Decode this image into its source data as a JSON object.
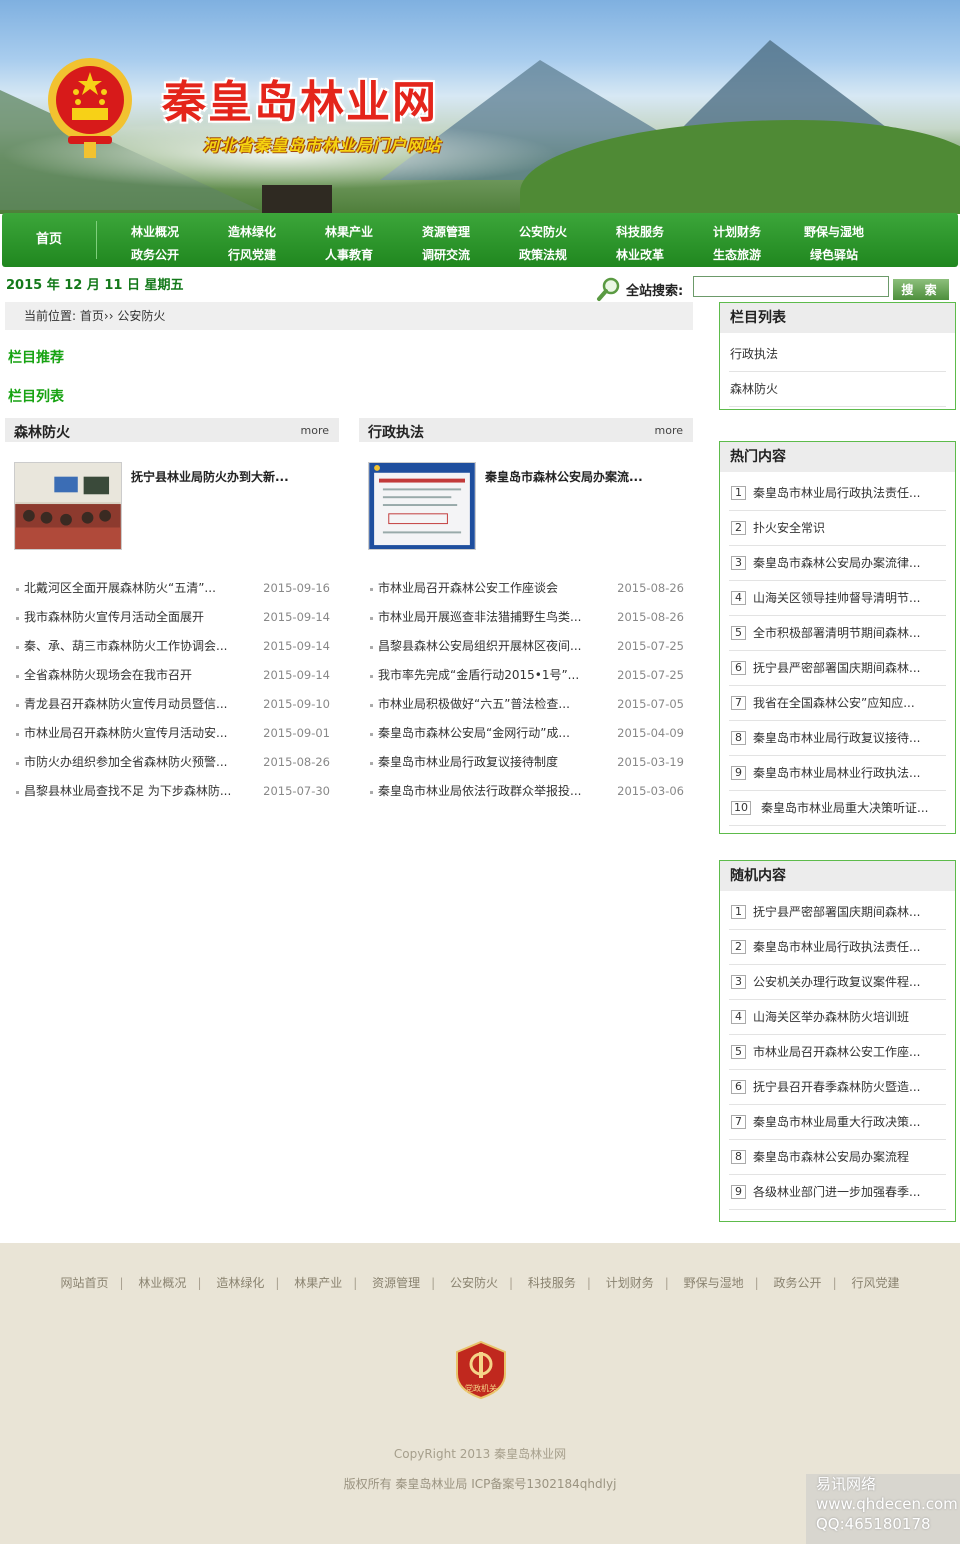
{
  "header": {
    "site_title": "秦皇岛林业网",
    "site_subtitle": "河北省秦皇岛市林业局门户网站"
  },
  "nav": {
    "home": "首页",
    "columns": [
      [
        "林业概况",
        "政务公开"
      ],
      [
        "造林绿化",
        "行风党建"
      ],
      [
        "林果产业",
        "人事教育"
      ],
      [
        "资源管理",
        "调研交流"
      ],
      [
        "公安防火",
        "政策法规"
      ],
      [
        "科技服务",
        "林业改革"
      ],
      [
        "计划财务",
        "生态旅游"
      ],
      [
        "野保与湿地",
        "绿色驿站"
      ]
    ]
  },
  "date": "2015 年 12 月 11 日 星期五",
  "search": {
    "label": "全站搜索:",
    "value": "",
    "button": "搜 索"
  },
  "breadcrumb": {
    "prefix": "当前位置:",
    "home": "首页",
    "sep": "››",
    "current": "公安防火"
  },
  "sections": {
    "recommend": "栏目推荐",
    "list": "栏目列表"
  },
  "boxes": [
    {
      "title": "森林防火",
      "more": "more",
      "lead": "抚宁县林业局防火办到大新...",
      "items": [
        {
          "title": "北戴河区全面开展森林防火“五清”...",
          "date": "2015-09-16"
        },
        {
          "title": "我市森林防火宣传月活动全面展开",
          "date": "2015-09-14"
        },
        {
          "title": "秦、承、葫三市森林防火工作协调会...",
          "date": "2015-09-14"
        },
        {
          "title": "全省森林防火现场会在我市召开",
          "date": "2015-09-14"
        },
        {
          "title": "青龙县召开森林防火宣传月动员暨信...",
          "date": "2015-09-10"
        },
        {
          "title": "市林业局召开森林防火宣传月活动安...",
          "date": "2015-09-01"
        },
        {
          "title": "市防火办组织参加全省森林防火预警...",
          "date": "2015-08-26"
        },
        {
          "title": "昌黎县林业局查找不足 为下步森林防...",
          "date": "2015-07-30"
        }
      ]
    },
    {
      "title": "行政执法",
      "more": "more",
      "lead": "秦皇岛市森林公安局办案流...",
      "items": [
        {
          "title": "市林业局召开森林公安工作座谈会",
          "date": "2015-08-26"
        },
        {
          "title": "市林业局开展巡查非法猎捕野生鸟类...",
          "date": "2015-08-26"
        },
        {
          "title": "昌黎县森林公安局组织开展林区夜间...",
          "date": "2015-07-25"
        },
        {
          "title": "我市率先完成“金盾行动2015•1号”...",
          "date": "2015-07-25"
        },
        {
          "title": "市林业局积极做好“六五”普法检查...",
          "date": "2015-07-05"
        },
        {
          "title": "秦皇岛市森林公安局“金网行动”成...",
          "date": "2015-04-09"
        },
        {
          "title": "秦皇岛市林业局行政复议接待制度",
          "date": "2015-03-19"
        },
        {
          "title": "秦皇岛市林业局依法行政群众举报投...",
          "date": "2015-03-06"
        }
      ]
    }
  ],
  "sidebar": {
    "category": {
      "title": "栏目列表",
      "items": [
        "行政执法",
        "森林防火"
      ]
    },
    "hot": {
      "title": "热门内容",
      "items": [
        {
          "n": "1",
          "t": "秦皇岛市林业局行政执法责任..."
        },
        {
          "n": "2",
          "t": "扑火安全常识"
        },
        {
          "n": "3",
          "t": "秦皇岛市森林公安局办案流律..."
        },
        {
          "n": "4",
          "t": "山海关区领导挂帅督导清明节..."
        },
        {
          "n": "5",
          "t": "全市积极部署清明节期间森林..."
        },
        {
          "n": "6",
          "t": "抚宁县严密部署国庆期间森林..."
        },
        {
          "n": "7",
          "t": "我省在全国森林公安”应知应..."
        },
        {
          "n": "8",
          "t": "秦皇岛市林业局行政复议接待..."
        },
        {
          "n": "9",
          "t": "秦皇岛市林业局林业行政执法..."
        },
        {
          "n": "10",
          "t": "秦皇岛市林业局重大决策听证..."
        }
      ]
    },
    "random": {
      "title": "随机内容",
      "items": [
        {
          "n": "1",
          "t": "抚宁县严密部署国庆期间森林..."
        },
        {
          "n": "2",
          "t": "秦皇岛市林业局行政执法责任..."
        },
        {
          "n": "3",
          "t": "公安机关办理行政复议案件程..."
        },
        {
          "n": "4",
          "t": "山海关区举办森林防火培训班"
        },
        {
          "n": "5",
          "t": "市林业局召开森林公安工作座..."
        },
        {
          "n": "6",
          "t": "抚宁县召开春季森林防火暨造..."
        },
        {
          "n": "7",
          "t": "秦皇岛市林业局重大行政决策..."
        },
        {
          "n": "8",
          "t": "秦皇岛市森林公安局办案流程"
        },
        {
          "n": "9",
          "t": "各级林业部门进一步加强春季..."
        }
      ]
    }
  },
  "footer": {
    "links": [
      "网站首页",
      "林业概况",
      "造林绿化",
      "林果产业",
      "资源管理",
      "公安防火",
      "科技服务",
      "计划财务",
      "野保与湿地",
      "政务公开",
      "行风党建"
    ],
    "badge_text": "党政机关",
    "copyright": "CopyRight 2013 秦皇岛林业网",
    "icp": "版权所有 秦皇岛林业局   ICP备案号1302184qhdlyj"
  },
  "watermark": [
    "易讯网络",
    "www.qhdecen.com",
    "QQ:465180178"
  ],
  "colors": {
    "nav_green": "#2b992a",
    "section_green": "#17a312",
    "date_green": "#13791a",
    "title_red": "#e4251b",
    "sidebar_border": "#5dbb4b"
  }
}
